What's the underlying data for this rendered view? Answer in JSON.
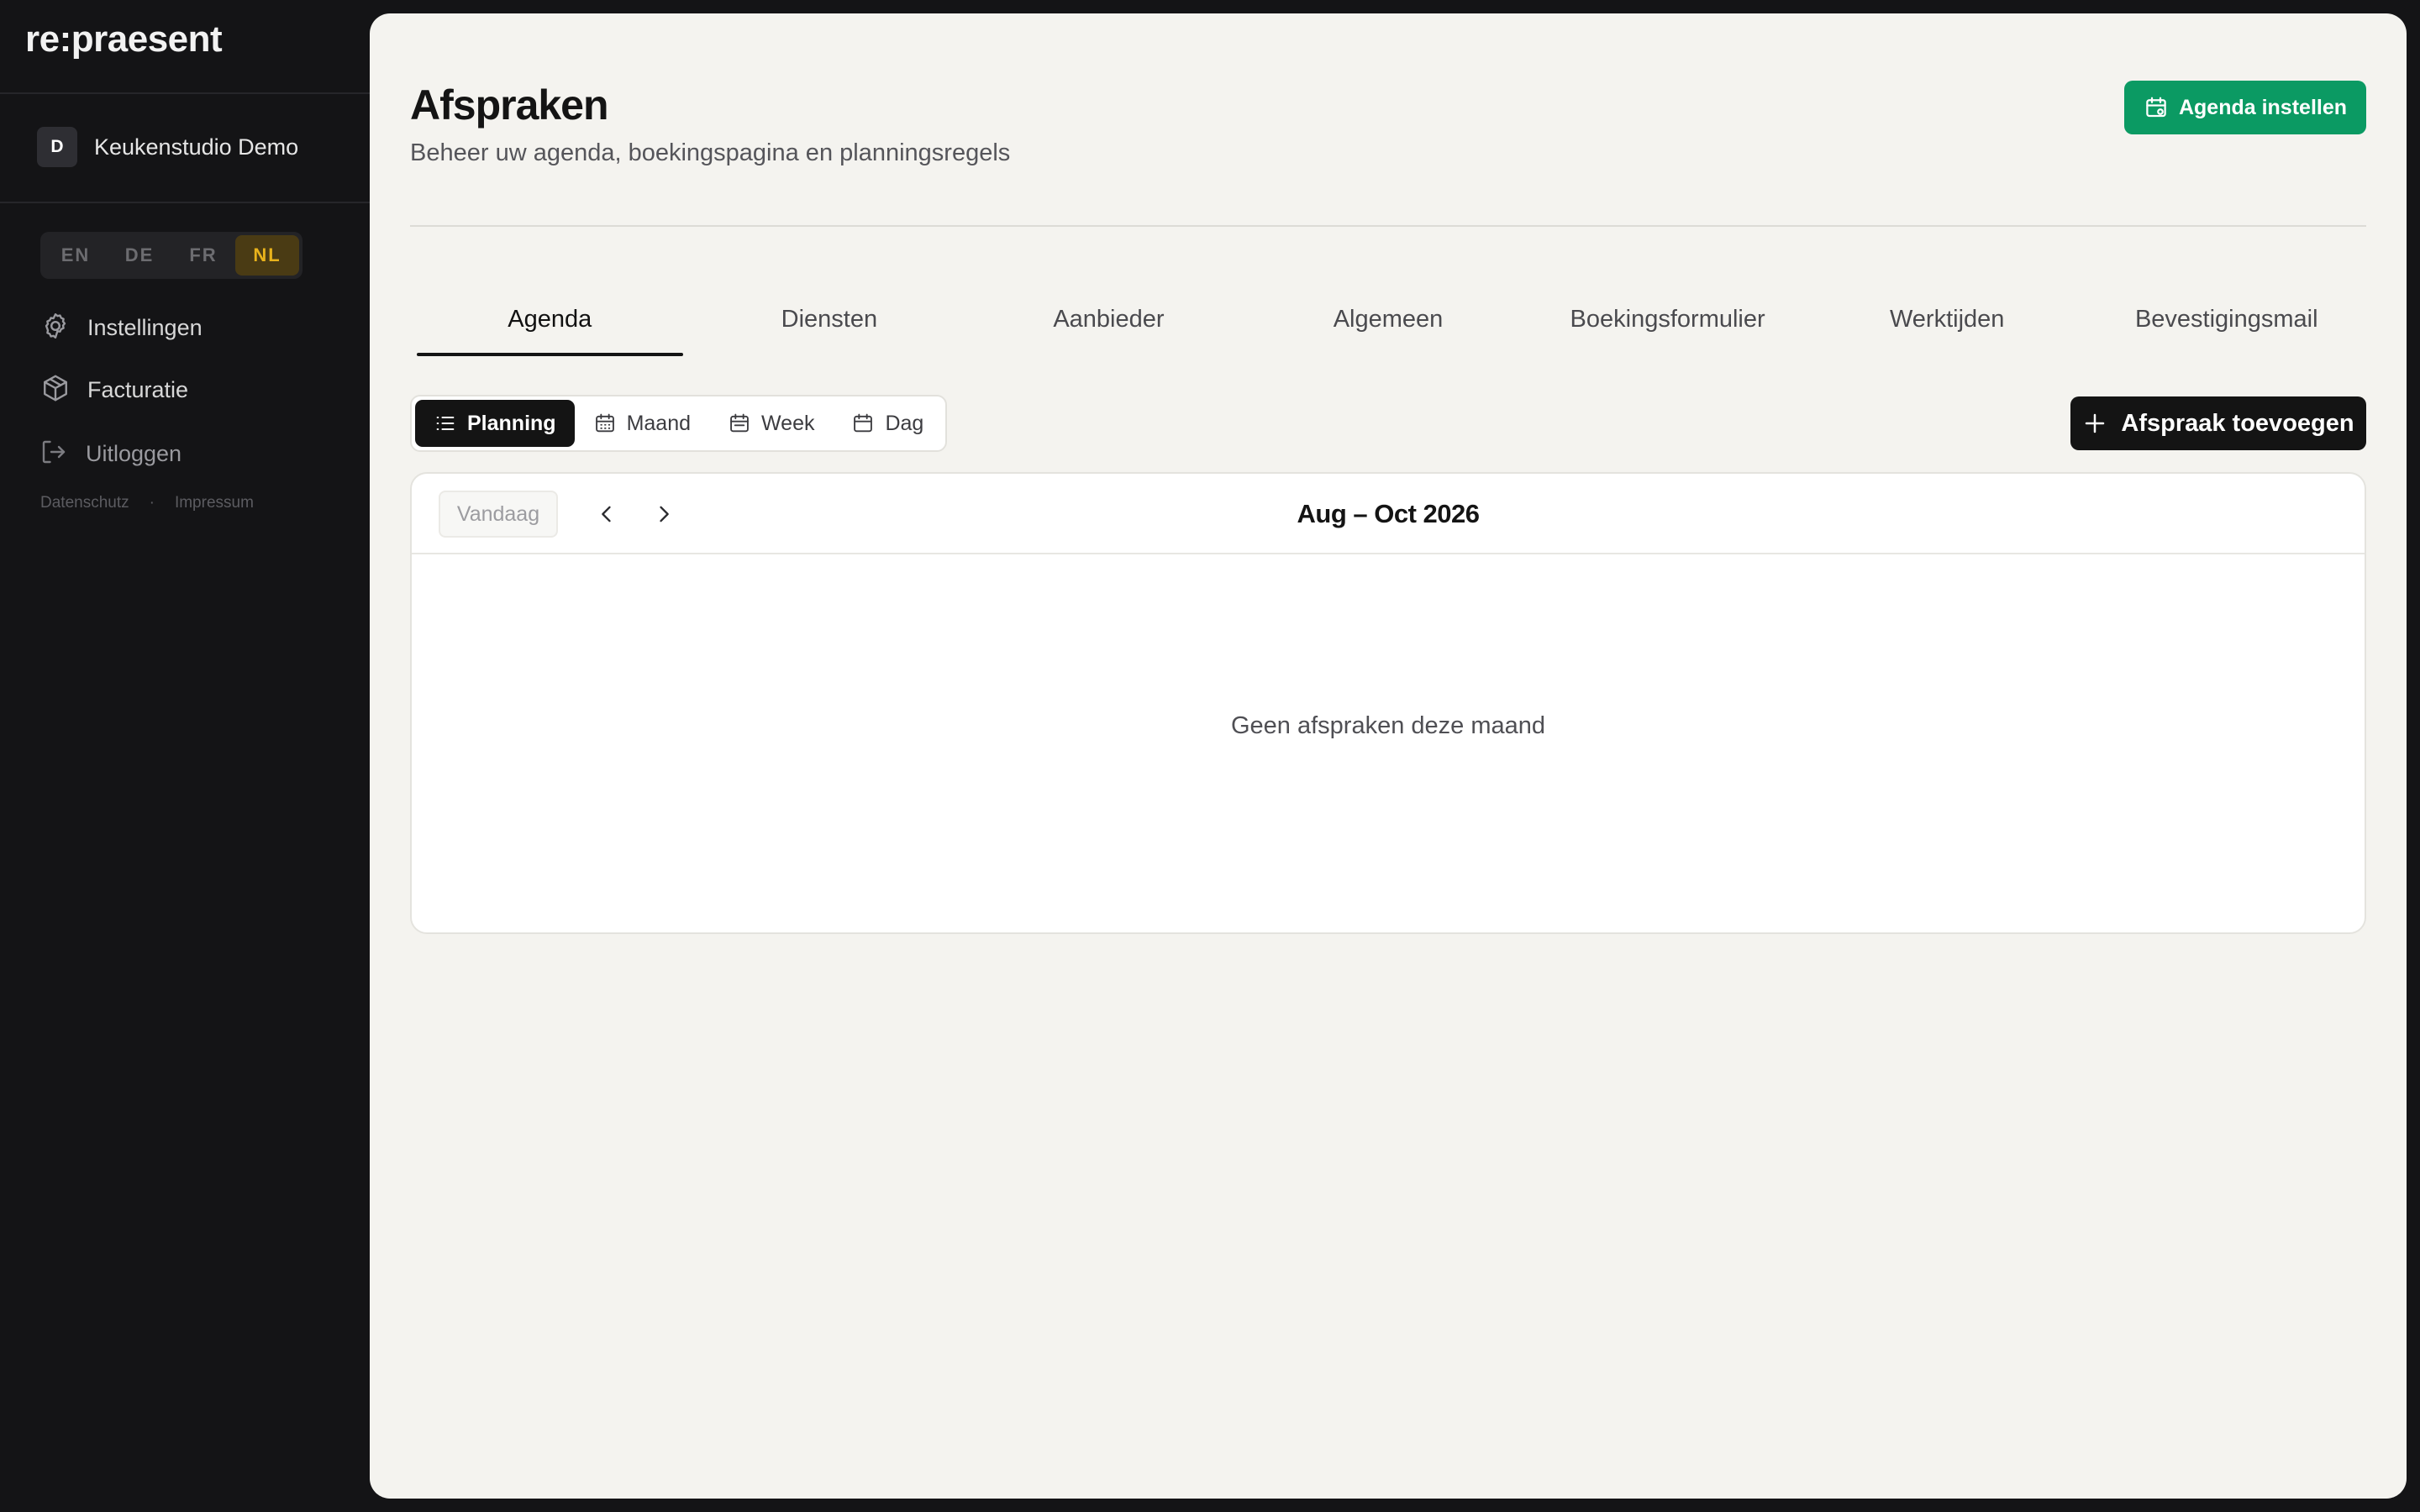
{
  "brand": {
    "logo": "re:praesent"
  },
  "org": {
    "initial": "D",
    "name": "Keukenstudio Demo"
  },
  "languages": [
    {
      "code": "EN",
      "active": false
    },
    {
      "code": "DE",
      "active": false
    },
    {
      "code": "FR",
      "active": false
    },
    {
      "code": "NL",
      "active": true
    }
  ],
  "nav": {
    "settings": {
      "label": "Instellingen",
      "icon": "gear-icon"
    },
    "billing": {
      "label": "Facturatie",
      "icon": "box-icon"
    },
    "logout": {
      "label": "Uitloggen",
      "icon": "logout-icon"
    }
  },
  "footer": {
    "privacy": "Datenschutz",
    "separator": "·",
    "imprint": "Impressum"
  },
  "page": {
    "title": "Afspraken",
    "subtitle": "Beheer uw agenda, boekingspagina en planningsregels",
    "setup_button": "Agenda instellen"
  },
  "tabs": [
    {
      "label": "Agenda",
      "active": true
    },
    {
      "label": "Diensten",
      "active": false
    },
    {
      "label": "Aanbieder",
      "active": false
    },
    {
      "label": "Algemeen",
      "active": false
    },
    {
      "label": "Boekingsformulier",
      "active": false
    },
    {
      "label": "Werktijden",
      "active": false
    },
    {
      "label": "Bevestigingsmail",
      "active": false
    }
  ],
  "views": {
    "planning": "Planning",
    "month": "Maand",
    "week": "Week",
    "day": "Dag",
    "selected": "Planning"
  },
  "add_button": "Afspraak toevoegen",
  "calendar": {
    "today": "Vandaag",
    "range": "Aug – Oct 2026",
    "empty": "Geen afspraken deze maand"
  },
  "colors": {
    "accent_green": "#0b9a63",
    "language_active": "#e8b21c",
    "sidebar_bg": "#141416",
    "panel_bg": "#f4f3ef"
  }
}
